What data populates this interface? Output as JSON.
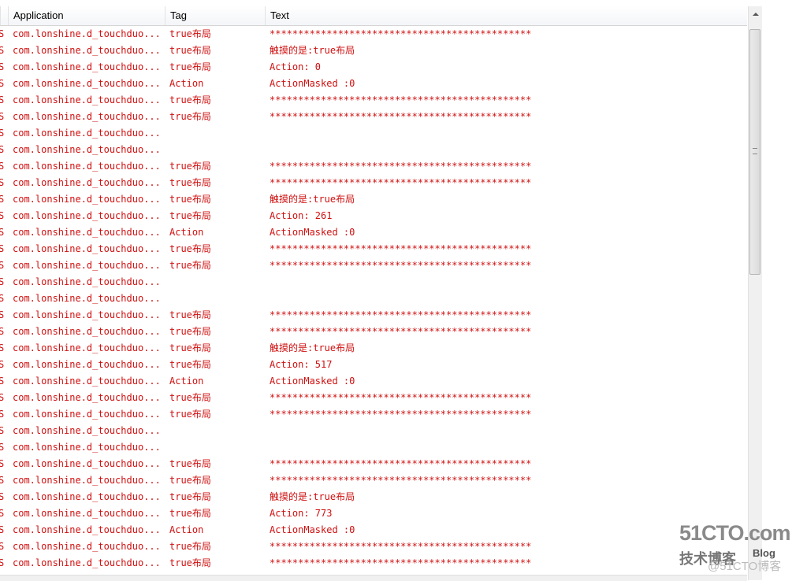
{
  "columns": {
    "application": "Application",
    "tag": "Tag",
    "text": "Text"
  },
  "level_marker": "S",
  "rows": [
    {
      "app": "com.lonshine.d_touchduo...",
      "tag": "true布局",
      "text": "**********************************************"
    },
    {
      "app": "com.lonshine.d_touchduo...",
      "tag": "true布局",
      "text": "触摸的是:true布局"
    },
    {
      "app": "com.lonshine.d_touchduo...",
      "tag": "true布局",
      "text": "Action: 0"
    },
    {
      "app": "com.lonshine.d_touchduo...",
      "tag": "Action",
      "text": "ActionMasked :0"
    },
    {
      "app": "com.lonshine.d_touchduo...",
      "tag": "true布局",
      "text": "**********************************************"
    },
    {
      "app": "com.lonshine.d_touchduo...",
      "tag": "true布局",
      "text": "**********************************************"
    },
    {
      "app": "com.lonshine.d_touchduo...",
      "tag": "",
      "text": ""
    },
    {
      "app": "com.lonshine.d_touchduo...",
      "tag": "",
      "text": ""
    },
    {
      "app": "com.lonshine.d_touchduo...",
      "tag": "true布局",
      "text": "**********************************************"
    },
    {
      "app": "com.lonshine.d_touchduo...",
      "tag": "true布局",
      "text": "**********************************************"
    },
    {
      "app": "com.lonshine.d_touchduo...",
      "tag": "true布局",
      "text": "触摸的是:true布局"
    },
    {
      "app": "com.lonshine.d_touchduo...",
      "tag": "true布局",
      "text": "Action: 261"
    },
    {
      "app": "com.lonshine.d_touchduo...",
      "tag": "Action",
      "text": "ActionMasked :0"
    },
    {
      "app": "com.lonshine.d_touchduo...",
      "tag": "true布局",
      "text": "**********************************************"
    },
    {
      "app": "com.lonshine.d_touchduo...",
      "tag": "true布局",
      "text": "**********************************************"
    },
    {
      "app": "com.lonshine.d_touchduo...",
      "tag": "",
      "text": ""
    },
    {
      "app": "com.lonshine.d_touchduo...",
      "tag": "",
      "text": ""
    },
    {
      "app": "com.lonshine.d_touchduo...",
      "tag": "true布局",
      "text": "**********************************************"
    },
    {
      "app": "com.lonshine.d_touchduo...",
      "tag": "true布局",
      "text": "**********************************************"
    },
    {
      "app": "com.lonshine.d_touchduo...",
      "tag": "true布局",
      "text": "触摸的是:true布局"
    },
    {
      "app": "com.lonshine.d_touchduo...",
      "tag": "true布局",
      "text": "Action: 517"
    },
    {
      "app": "com.lonshine.d_touchduo...",
      "tag": "Action",
      "text": "ActionMasked :0"
    },
    {
      "app": "com.lonshine.d_touchduo...",
      "tag": "true布局",
      "text": "**********************************************"
    },
    {
      "app": "com.lonshine.d_touchduo...",
      "tag": "true布局",
      "text": "**********************************************"
    },
    {
      "app": "com.lonshine.d_touchduo...",
      "tag": "",
      "text": ""
    },
    {
      "app": "com.lonshine.d_touchduo...",
      "tag": "",
      "text": ""
    },
    {
      "app": "com.lonshine.d_touchduo...",
      "tag": "true布局",
      "text": "**********************************************"
    },
    {
      "app": "com.lonshine.d_touchduo...",
      "tag": "true布局",
      "text": "**********************************************"
    },
    {
      "app": "com.lonshine.d_touchduo...",
      "tag": "true布局",
      "text": "触摸的是:true布局"
    },
    {
      "app": "com.lonshine.d_touchduo...",
      "tag": "true布局",
      "text": "Action: 773"
    },
    {
      "app": "com.lonshine.d_touchduo...",
      "tag": "Action",
      "text": "ActionMasked :0"
    },
    {
      "app": "com.lonshine.d_touchduo...",
      "tag": "true布局",
      "text": "**********************************************"
    },
    {
      "app": "com.lonshine.d_touchduo...",
      "tag": "true布局",
      "text": "**********************************************"
    }
  ],
  "colors": {
    "log_text": "#d01010"
  },
  "watermark": {
    "line1": "51CTO.com",
    "line2": "技术博客",
    "line3": "Blog",
    "line4": "@51CTO博客"
  }
}
